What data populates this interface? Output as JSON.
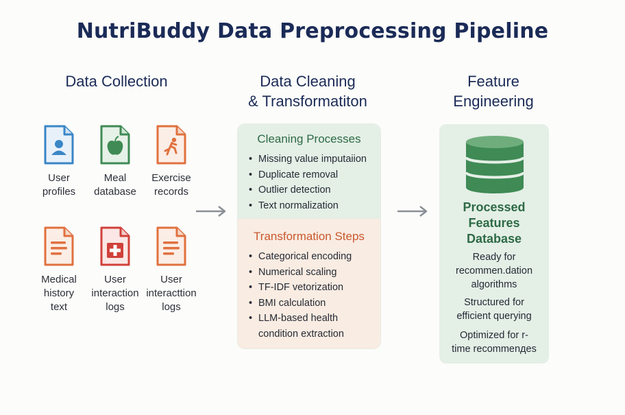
{
  "title": "NutriBuddy Data Preprocessing Pipeline",
  "columns": {
    "collection": "Data Collection",
    "cleaning": "Data Cleaning\n& Transformatiton",
    "feature": "Feature\nEngineering"
  },
  "sources": [
    {
      "label": "User\nprofiles",
      "icon": "user-profile-icon",
      "color": "#3a86c6"
    },
    {
      "label": "Meal\ndatabase",
      "icon": "meal-apple-icon",
      "color": "#3f8a55"
    },
    {
      "label": "Exercise\nrecords",
      "icon": "exercise-runner-icon",
      "color": "#e0713f"
    },
    {
      "label": "Medical\nhistory\ntext",
      "icon": "medical-document-icon",
      "color": "#e0713f"
    },
    {
      "label": "User\ninteraction\nlogs",
      "icon": "medical-cross-document-icon",
      "color": "#d0413a"
    },
    {
      "label": "User\ninteracttion\nlogs",
      "icon": "text-document-icon",
      "color": "#e0713f"
    }
  ],
  "cleaning": {
    "title": "Cleaning Processes",
    "items": [
      "Missing value imputaiion",
      "Duplicate removal",
      "Outlier detection",
      "Text normalization"
    ]
  },
  "transformation": {
    "title": "Transformation Steps",
    "items": [
      "Categorical encoding",
      "Numerical scaling",
      "TF-IDF vetorization",
      "BMI calculation",
      "LLM-based health\ncondition extraction"
    ]
  },
  "feature": {
    "db_icon": "database-icon",
    "db_title": "Processed\nFeatures\nDatabase",
    "notes": [
      "Ready for\nrecommen.dation\nalgorithms",
      "Structured for\nefficient querying",
      "Optimized for r-\ntime recommenдes"
    ]
  },
  "colors": {
    "title": "#1b2b57",
    "cleaning_bg": "#e4efe6",
    "transform_bg": "#f9ece2",
    "cleaning_accent": "#2d6a45",
    "transform_accent": "#c9582d",
    "arrow": "#8a8f96"
  }
}
